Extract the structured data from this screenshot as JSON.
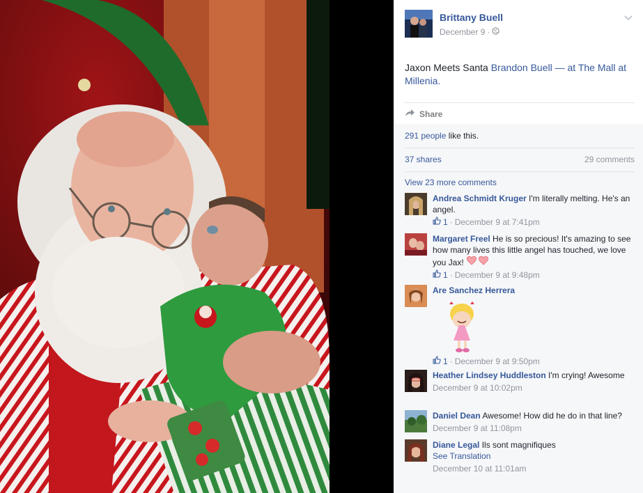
{
  "post": {
    "author": "Brittany Buell",
    "date": "December 9",
    "date_sep": "·",
    "text": "Jaxon Meets Santa",
    "tagged": "Brandon Buell",
    "dash": "— at",
    "place": "The Mall at Millenia.",
    "share_label": "Share",
    "likes_count": "291 people",
    "likes_suffix": "like this.",
    "shares": "37 shares",
    "comments_count": "29 comments",
    "view_more": "View 23 more comments"
  },
  "comments": [
    {
      "name": "Andrea Schmidt Kruger",
      "text": "I'm literally melting. He's an angel.",
      "likes": "1",
      "time": "December 9 at 7:41pm"
    },
    {
      "name": "Margaret Freel",
      "text": "He is so precious! It's amazing to see how many lives this little angel has touched, we love you Jax!",
      "likes": "1",
      "time": "December 9 at 9:48pm"
    },
    {
      "name": "Are Sanchez Herrera",
      "text": "",
      "likes": "1",
      "time": "December 9 at 9:50pm"
    },
    {
      "name": "Heather Lindsey Huddleston",
      "text": "I'm crying! Awesome",
      "time": "December 9 at 10:02pm"
    },
    {
      "name": "Daniel Dean",
      "text": "Awesome! How did he do in that line?",
      "time": "December 9 at 11:08pm"
    },
    {
      "name": "Diane Legal",
      "text": "Ils sont magnifiques",
      "translation": "See Translation",
      "time": "December 10 at 11:01am"
    }
  ],
  "meta_sep": "·",
  "icons": {
    "globe": "globe-icon",
    "chevron": "chevron-down-icon",
    "share": "share-arrow-icon",
    "like": "thumbs-up-icon"
  },
  "colors": {
    "link": "#365899",
    "muted": "#90949c",
    "feedback_bg": "#f6f7f9"
  }
}
